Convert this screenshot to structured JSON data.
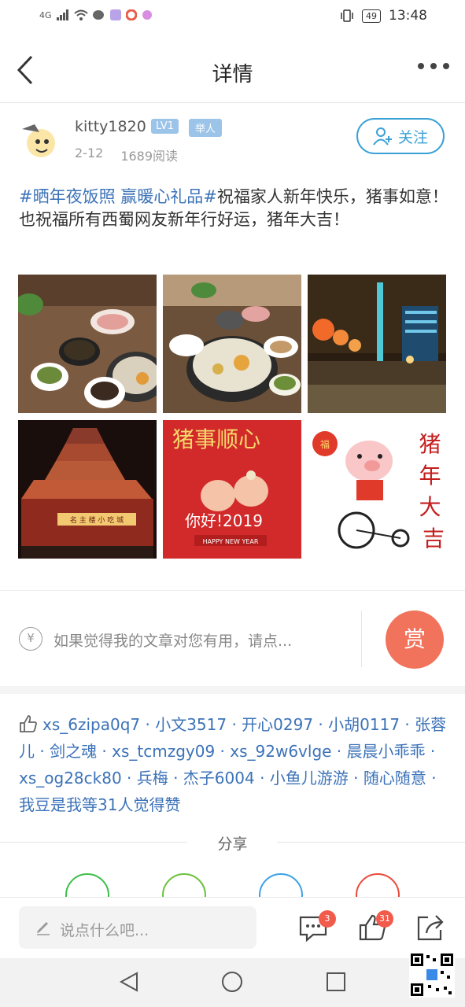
{
  "status_bar": {
    "network": "4G",
    "battery": "49",
    "time": "13:48"
  },
  "nav": {
    "title": "详情"
  },
  "author": {
    "name": "kitty1820",
    "level": "LV1",
    "rank": "举人",
    "date": "2-12",
    "reads": "1689阅读",
    "follow_label": "关注"
  },
  "post": {
    "tag1": "#晒年夜饭照",
    "tag2": "赢暖心礼品#",
    "text": "祝福家人新年快乐，猪事如意！也祝福所有西蜀网友新年行好运，猪年大吉！"
  },
  "images": [
    {
      "name": "hotpot-dinner-photo-1"
    },
    {
      "name": "hotpot-dinner-photo-2"
    },
    {
      "name": "city-night-photo"
    },
    {
      "name": "pagoda-night-photo",
      "sign_text": "名 主 楼 小 吃 城"
    },
    {
      "name": "pig-greeting-card",
      "title": "猪事顺心",
      "greeting": "你好!2019",
      "banner": "HAPPY NEW YEAR"
    },
    {
      "name": "pig-bike-card",
      "caption": "猪年大吉",
      "lantern": "福"
    }
  ],
  "reward": {
    "placeholder": "如果觉得我的文章对您有用，请点...",
    "button": "赏",
    "currency_icon": "¥"
  },
  "likes": {
    "names": "xs_6zipa0q7 · 小文3517 · 开心0297 · 小胡0117 · 张蓉儿 · 剑之魂 · xs_tcmzgy09 · xs_92w6vlge · 晨晨小乖乖 · xs_og28ck80 · 兵梅 · 杰子6004 · 小鱼儿游游 · 随心随意 · 我豆是我等31人觉得赞"
  },
  "share": {
    "label": "分享"
  },
  "bottom": {
    "comment_placeholder": "说点什么吧...",
    "comment_count": "3",
    "like_count": "31"
  },
  "colors": {
    "accent": "#3aa1d6",
    "tag": "#3b72b8",
    "reward": "#f2735c",
    "badge": "#f25b4b"
  }
}
